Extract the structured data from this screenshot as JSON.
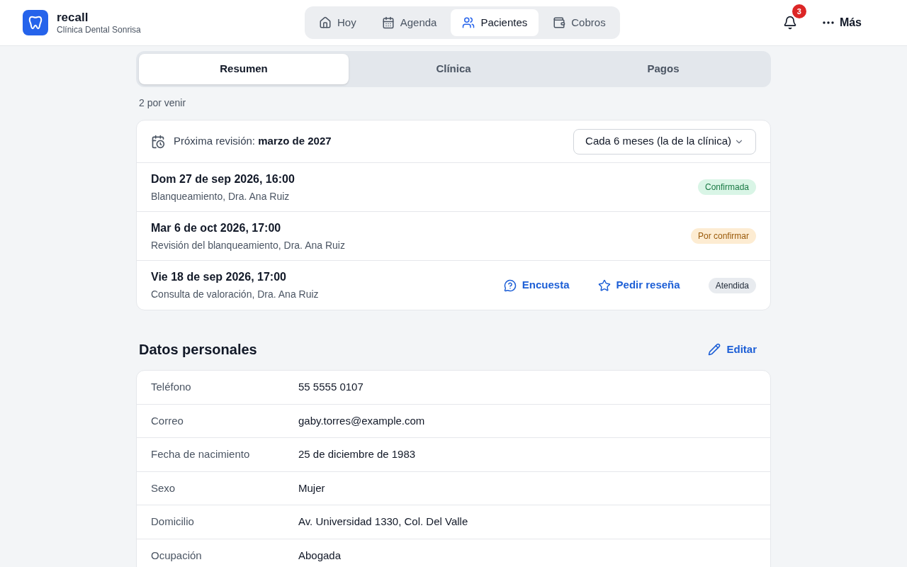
{
  "header": {
    "brand": "recall",
    "clinic": "Clínica Dental Sonrisa",
    "nav": [
      {
        "label": "Hoy",
        "selected": false
      },
      {
        "label": "Agenda",
        "selected": false
      },
      {
        "label": "Pacientes",
        "selected": true
      },
      {
        "label": "Cobros",
        "selected": false
      }
    ],
    "notifications": "3",
    "more": "Más"
  },
  "tabs": [
    {
      "label": "Resumen",
      "selected": true
    },
    {
      "label": "Clínica",
      "selected": false
    },
    {
      "label": "Pagos",
      "selected": false
    }
  ],
  "appointments_count": "2 por venir",
  "recall": {
    "label": "Próxima revisión:",
    "value": "marzo de 2027",
    "interval": "Cada 6 meses (la de la clínica)"
  },
  "appointments": [
    {
      "when": "Dom 27 de sep 2026, 16:00",
      "detail": "Blanqueamiento, Dra. Ana Ruiz",
      "status": "Confirmada",
      "kind": "confirmed"
    },
    {
      "when": "Mar 6 de oct 2026, 17:00",
      "detail": "Revisión del blanqueamiento, Dra. Ana Ruiz",
      "status": "Por confirmar",
      "kind": "pending"
    },
    {
      "when": "Vie 18 de sep 2026, 17:00",
      "detail": "Consulta de valoración, Dra. Ana Ruiz",
      "status": "Atendida",
      "kind": "done",
      "actions": [
        "Encuesta",
        "Pedir reseña"
      ]
    }
  ],
  "personal": {
    "title": "Datos personales",
    "edit": "Editar",
    "rows": [
      {
        "label": "Teléfono",
        "value": "55 5555 0107"
      },
      {
        "label": "Correo",
        "value": "gaby.torres@example.com"
      },
      {
        "label": "Fecha de nacimiento",
        "value": "25 de diciembre de 1983"
      },
      {
        "label": "Sexo",
        "value": "Mujer"
      },
      {
        "label": "Domicilio",
        "value": "Av. Universidad 1330, Col. Del Valle"
      },
      {
        "label": "Ocupación",
        "value": "Abogada"
      }
    ]
  }
}
